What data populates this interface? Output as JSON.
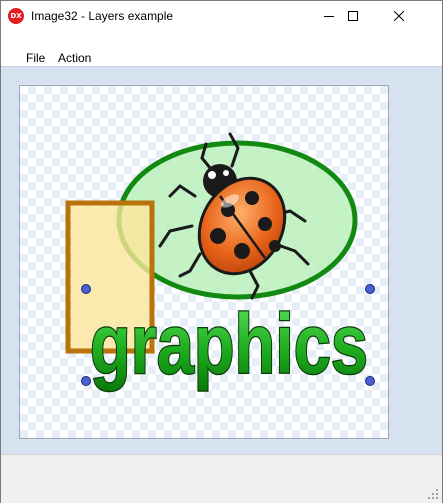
{
  "window": {
    "title": "Image32 - Layers example",
    "icon_text": "DX",
    "icons": {
      "app": "app-icon",
      "minimize": "minimize-icon",
      "maximize": "maximize-icon",
      "close": "close-icon"
    }
  },
  "menu": {
    "items": [
      {
        "label": "File"
      },
      {
        "label": "Action"
      }
    ]
  },
  "canvas": {
    "graphic_text": "graphics",
    "colors": {
      "background": "#d6e2f0",
      "ellipse_fill": "#b8f0b8",
      "ellipse_stroke": "#128a12",
      "rect_fill": "#fde69a",
      "rect_stroke": "#b8730a",
      "text_fill": "#2ec42e",
      "handle": "#4a5fd0",
      "ladybug_shell": "#e8641a"
    }
  }
}
